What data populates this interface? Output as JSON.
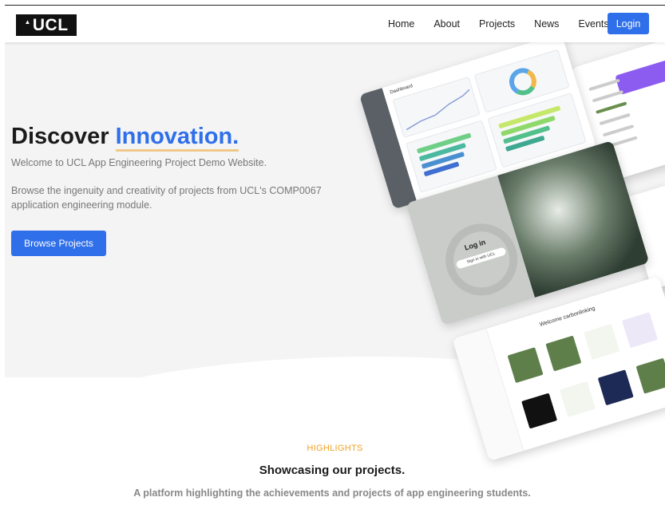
{
  "nav": {
    "logo": "UCL",
    "links": [
      "Home",
      "About",
      "Projects",
      "News",
      "Events"
    ],
    "login": "Login"
  },
  "hero": {
    "headline_prefix": "Discover ",
    "headline_accent": "Innovation.",
    "welcome": "Welcome to UCL App Engineering Project Demo Website.",
    "description": "Browse the ingenuity and creativity of projects from UCL's COMP0067 application engineering module.",
    "cta": "Browse Projects"
  },
  "collage": {
    "dashboard_title": "Dashboard",
    "login_title": "Log in",
    "login_button": "Sign in with UCL",
    "welcome_title": "Welcome carbonlinking"
  },
  "highlights": {
    "label": "HIGHLIGHTS",
    "title": "Showcasing our projects.",
    "subtitle": "A platform highlighting the achievements and projects of app engineering students."
  },
  "colors": {
    "accent": "#2f6fea",
    "highlight_label": "#f0a226",
    "underline": "#f0c98a"
  }
}
